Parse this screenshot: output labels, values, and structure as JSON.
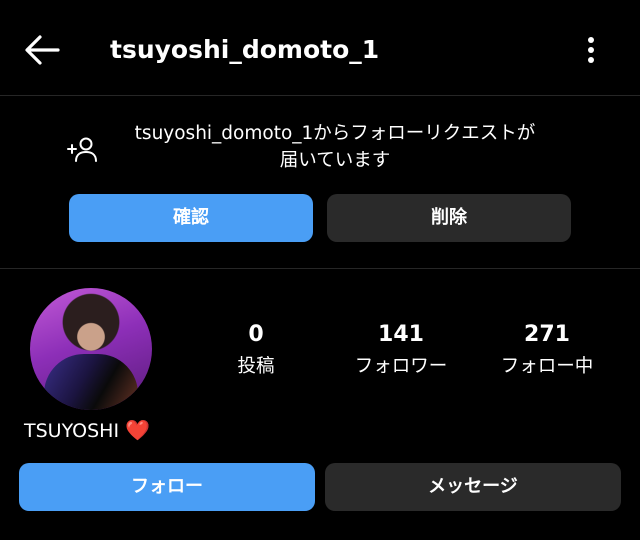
{
  "header": {
    "username": "tsuyoshi_domoto_1",
    "back_icon": "arrow-left-icon",
    "more_icon": "more-vertical-icon"
  },
  "follow_request": {
    "icon": "person-add-icon",
    "message_line1": "tsuyoshi_domoto_1からフォローリクエストが",
    "message_line2": "届いています",
    "confirm_label": "確認",
    "delete_label": "削除"
  },
  "profile": {
    "display_name": "TSUYOSHI",
    "name_emoji": "❤️",
    "stats": [
      {
        "value": "0",
        "label": "投稿"
      },
      {
        "value": "141",
        "label": "フォロワー"
      },
      {
        "value": "271",
        "label": "フォロー中"
      }
    ]
  },
  "actions": {
    "follow_label": "フォロー",
    "message_label": "メッセージ"
  },
  "colors": {
    "background": "#000000",
    "primary_button": "#4a9ef5",
    "secondary_button": "#2a2a2a",
    "divider": "#262626",
    "heart": "#e8463f"
  }
}
